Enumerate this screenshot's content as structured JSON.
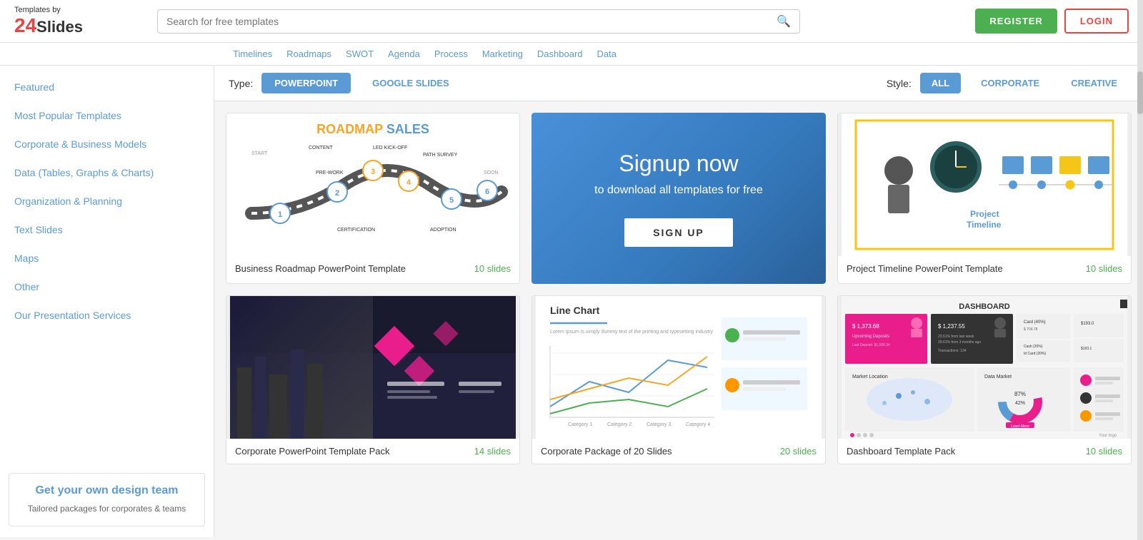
{
  "header": {
    "logo_by": "Templates by",
    "logo_24": "24",
    "logo_slides": "Slides",
    "search_placeholder": "Search for free templates",
    "register_label": "REGISTER",
    "login_label": "LOGIN"
  },
  "subnav": {
    "items": [
      "Timelines",
      "Roadmaps",
      "SWOT",
      "Agenda",
      "Process",
      "Marketing",
      "Dashboard",
      "Data"
    ]
  },
  "filter": {
    "type_label": "Type:",
    "type_options": [
      {
        "label": "POWERPOINT",
        "active": true
      },
      {
        "label": "GOOGLE SLIDES",
        "active": false
      }
    ],
    "style_label": "Style:",
    "style_options": [
      {
        "label": "ALL",
        "active": true
      },
      {
        "label": "CORPORATE",
        "active": false
      },
      {
        "label": "CREATIVE",
        "active": false
      }
    ]
  },
  "sidebar": {
    "items": [
      {
        "label": "Featured",
        "active": false
      },
      {
        "label": "Most Popular Templates",
        "active": false
      },
      {
        "label": "Corporate & Business Models",
        "active": false
      },
      {
        "label": "Data (Tables, Graphs & Charts)",
        "active": false
      },
      {
        "label": "Organization & Planning",
        "active": false
      },
      {
        "label": "Text Slides",
        "active": false
      },
      {
        "label": "Maps",
        "active": false
      },
      {
        "label": "Other",
        "active": false
      },
      {
        "label": "Our Presentation Services",
        "active": false
      }
    ],
    "promo": {
      "title": "Get your own design team",
      "text": "Tailored packages for corporates & teams"
    }
  },
  "templates": [
    {
      "title": "Business Roadmap PowerPoint Template",
      "slides": "10 slides",
      "type": "roadmap"
    },
    {
      "title": "Signup now",
      "subtitle": "to download all templates for free",
      "button": "SIGN UP",
      "type": "signup"
    },
    {
      "title": "Project Timeline PowerPoint Template",
      "slides": "10 slides",
      "type": "timeline"
    },
    {
      "title": "Corporate PowerPoint Template Pack",
      "slides": "14 slides",
      "type": "corporate"
    },
    {
      "title": "Corporate Package of 20 Slides",
      "slides": "20 slides",
      "type": "linechart"
    },
    {
      "title": "Dashboard Template Pack",
      "slides": "10 slides",
      "type": "dashboard"
    }
  ]
}
